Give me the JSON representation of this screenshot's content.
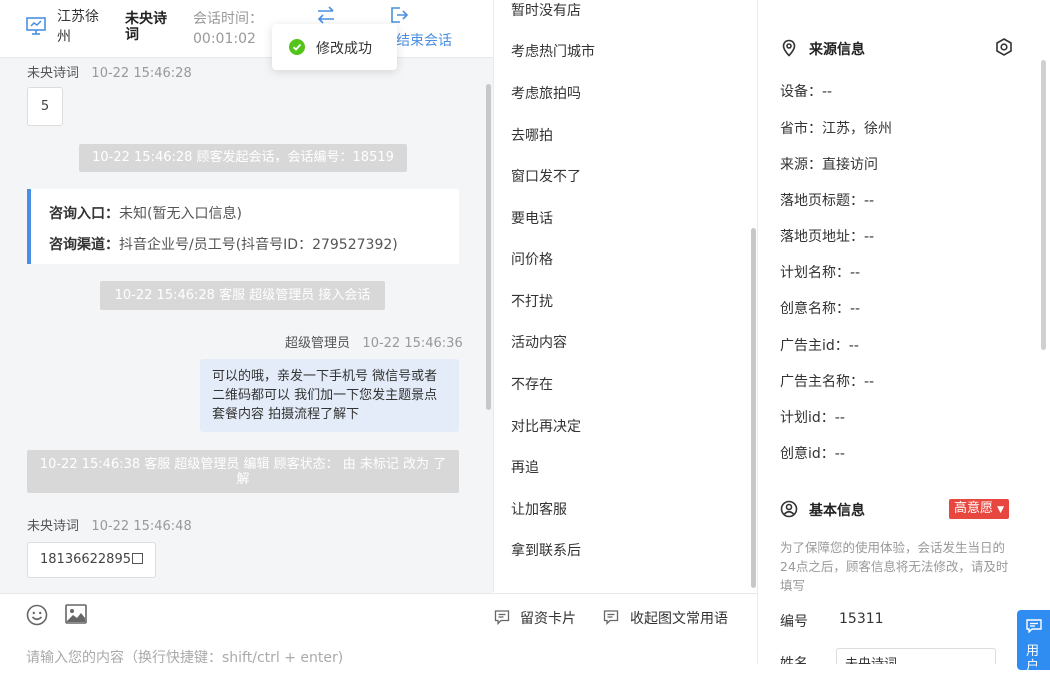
{
  "header": {
    "location": "江苏徐州",
    "visitor_name": "未央诗词",
    "session_time_label": "会话时间：",
    "session_time": "00:01:02",
    "end_session": "结束会话",
    "icons": {
      "monitor": "monitor-icon",
      "transfer": "transfer-icon",
      "exit": "exit-icon"
    }
  },
  "toast": {
    "text": "修改成功",
    "icon": "check-circle-icon"
  },
  "chat": {
    "msg1_sender": "未央诗词",
    "msg1_time": "10-22 15:46:28",
    "msg1_text": "5",
    "sys1": "10-22 15:46:28 顾客发起会话，会话编号：18519",
    "entry_label": "咨询入口：",
    "entry_value": "未知(暂无入口信息)",
    "channel_label": "咨询渠道：",
    "channel_value": "抖音企业号/员工号(抖音号ID：279527392)",
    "sys2": "10-22 15:46:28 客服 超级管理员 接入会话",
    "agent_sender": "超级管理员",
    "agent_time": "10-22 15:46:36",
    "agent_text": "可以的哦，亲发一下手机号 微信号或者二维码都可以 我们加一下您发主题景点 套餐内容 拍摄流程了解下",
    "sys3": "10-22 15:46:38 客服 超级管理员 编辑 顾客状态： 由 未标记 改为 了解",
    "msg2_sender": "未央诗词",
    "msg2_time": "10-22 15:46:48",
    "msg2_text": "18136622895"
  },
  "input": {
    "card_label": "留资卡片",
    "fav_label": "收起图文常用语",
    "placeholder": "请输入您的内容（换行快捷键：shift/ctrl + enter)"
  },
  "quick_replies": [
    "暂时没有店",
    "考虑热门城市",
    "考虑旅拍吗",
    "去哪拍",
    "窗口发不了",
    "要电话",
    "问价格",
    "不打扰",
    "活动内容",
    "不存在",
    "对比再决定",
    "再追",
    "让加客服",
    "拿到联系后"
  ],
  "source_info": {
    "title": "来源信息",
    "rows": [
      "设备：--",
      "省市：江苏，徐州",
      "来源：直接访问",
      "落地页标题：--",
      "落地页地址：--",
      "计划名称：--",
      "创意名称：--",
      "广告主id：--",
      "广告主名称：--",
      "计划id：--",
      "创意id：--"
    ]
  },
  "basic_info": {
    "title": "基本信息",
    "badge": "高意愿",
    "tip": "为了保障您的使用体验，会话发生当日的24点之后，顾客信息将无法修改，请及时填写",
    "id_label": "编号",
    "id_value": "15311",
    "next_label": "姓名",
    "next_value": "未央诗词"
  },
  "float_button": {
    "text": "用户"
  },
  "colors": {
    "accent": "#4a90e2",
    "badge": "#e8473f",
    "success": "#52c41a",
    "float": "#2f8cf0"
  }
}
